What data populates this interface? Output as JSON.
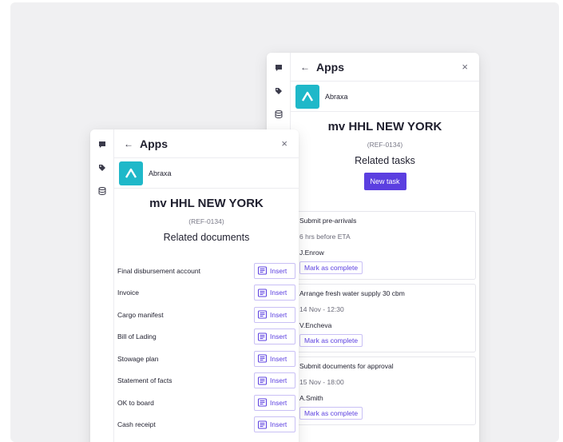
{
  "colors": {
    "accent": "#5b3fe0",
    "app_logo": "#1fb8c9",
    "background": "#f0f0f2"
  },
  "rail_icons": [
    "chat-icon",
    "tag-icon",
    "database-icon"
  ],
  "tasks_panel": {
    "header_title": "Apps",
    "back_symbol": "←",
    "close_symbol": "×",
    "app_name": "Abraxa",
    "vessel_name": "mv HHL NEW YORK",
    "reference": "(REF-0134)",
    "section_title": "Related tasks",
    "new_task_label": "New task",
    "tasks": [
      {
        "title": "Submit pre-arrivals",
        "when": "6 hrs before ETA",
        "assignee": "J.Enrow",
        "action": "Mark as complete"
      },
      {
        "title": "Arrange fresh water supply 30 cbm",
        "when": "14 Nov - 12:30",
        "assignee": "V.Encheva",
        "action": "Mark as complete"
      },
      {
        "title": "Submit documents for approval",
        "when": "15 Nov - 18:00",
        "assignee": "A.Smith",
        "action": "Mark as complete"
      }
    ]
  },
  "documents_panel": {
    "header_title": "Apps",
    "back_symbol": "←",
    "close_symbol": "×",
    "app_name": "Abraxa",
    "vessel_name": "mv HHL NEW YORK",
    "reference": "(REF-0134)",
    "section_title": "Related documents",
    "insert_label": "Insert",
    "documents": [
      "Final disbursement account",
      "Invoice",
      "Cargo manifest",
      "Bill of Lading",
      "Stowage plan",
      "Statement of facts",
      "OK to board",
      "Cash receipt"
    ]
  }
}
